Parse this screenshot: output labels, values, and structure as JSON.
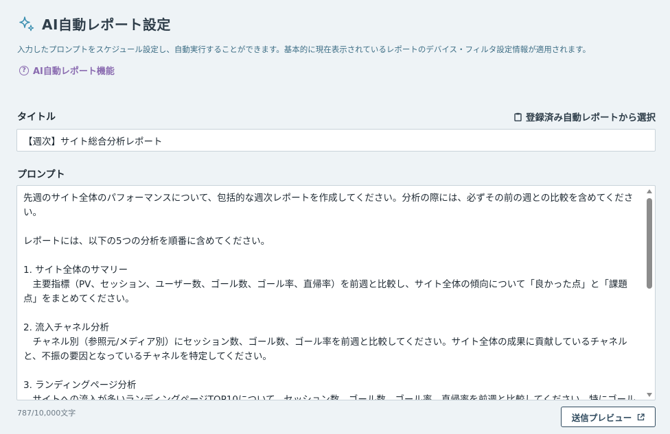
{
  "header": {
    "title": "AI自動レポート設定",
    "description": "入力したプロンプトをスケジュール設定し、自動実行することができます。基本的に現在表示されているレポートのデバイス・フィルタ設定情報が適用されます。",
    "help_link": "AI自動レポート機能",
    "icon": "sparkle-icon"
  },
  "title_field": {
    "label": "タイトル",
    "value": "【週次】サイト総合分析レポート",
    "select_link": "登録済み自動レポートから選択"
  },
  "prompt_field": {
    "label": "プロンプト",
    "value": "先週のサイト全体のパフォーマンスについて、包括的な週次レポートを作成してください。分析の際には、必ずその前の週との比較を含めてください。\n\nレポートには、以下の5つの分析を順番に含めてください。\n\n1. サイト全体のサマリー\n　主要指標（PV、セッション、ユーザー数、ゴール数、ゴール率、直帰率）を前週と比較し、サイト全体の傾向について「良かった点」と「課題点」をまとめてください。\n\n2. 流入チャネル分析\n　チャネル別（参照元/メディア別）にセッション数、ゴール数、ゴール率を前週と比較してください。サイト全体の成果に貢献しているチャネルと、不振の要因となっているチャネルを特定してください。\n\n3. ランディングページ分析\n　サイトへの流入が多いランディングページTOP10について、セッション数、ゴール数、ゴール率、直帰率を前週と比較してください。特にゴール率の変化が大きいページを抽出してください。",
    "char_count": "787/10,000文字"
  },
  "actions": {
    "preview_button": "送信プレビュー"
  },
  "colors": {
    "background": "#eef3f6",
    "accent_purple": "#8a6bb0",
    "description_text": "#3f6f86",
    "button_border": "#2f4a5e"
  }
}
